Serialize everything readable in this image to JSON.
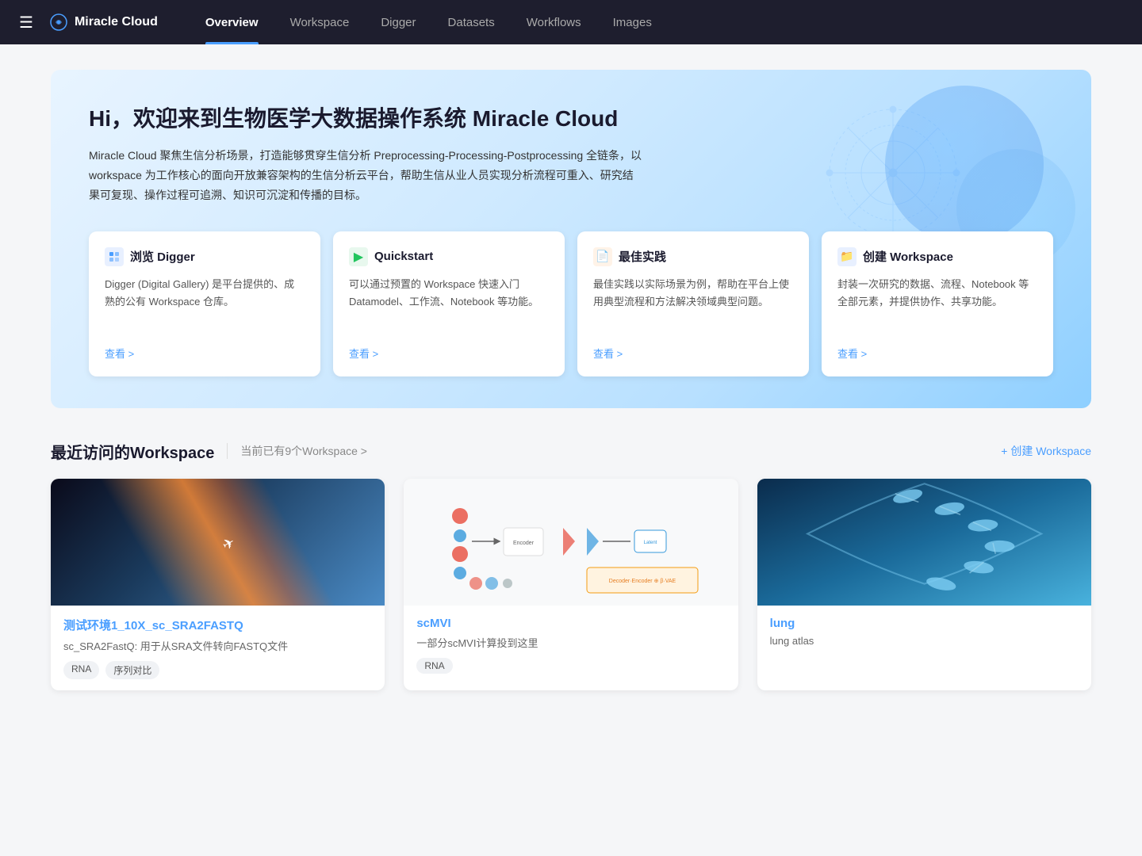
{
  "navbar": {
    "brand": "Miracle Cloud",
    "hamburger_icon": "☰",
    "links": [
      {
        "label": "Overview",
        "active": true
      },
      {
        "label": "Workspace",
        "active": false
      },
      {
        "label": "Digger",
        "active": false
      },
      {
        "label": "Datasets",
        "active": false
      },
      {
        "label": "Workflows",
        "active": false
      },
      {
        "label": "Images",
        "active": false
      }
    ]
  },
  "hero": {
    "title": "Hi，欢迎来到生物医学大数据操作系统 Miracle Cloud",
    "description": "Miracle Cloud 聚焦生信分析场景，打造能够贯穿生信分析 Preprocessing-Processing-Postprocessing 全链条，以 workspace 为工作核心的面向开放兼容架构的生信分析云平台，帮助生信从业人员实现分析流程可重入、研究结果可复现、操作过程可追溯、知识可沉淀和传播的目标。",
    "cards": [
      {
        "id": "digger",
        "icon": "📋",
        "icon_class": "icon-blue",
        "title": "浏览 Digger",
        "desc": "Digger (Digital Gallery) 是平台提供的、成熟的公有 Workspace 仓库。",
        "link": "查看 >"
      },
      {
        "id": "quickstart",
        "icon": "▶",
        "icon_class": "icon-green",
        "title": "Quickstart",
        "desc": "可以通过预置的 Workspace 快速入门 Datamodel、工作流、Notebook 等功能。",
        "link": "查看 >"
      },
      {
        "id": "best-practice",
        "icon": "📄",
        "icon_class": "icon-orange",
        "title": "最佳实践",
        "desc": "最佳实践以实际场景为例，帮助在平台上使用典型流程和方法解决领域典型问题。",
        "link": "查看 >"
      },
      {
        "id": "create-workspace",
        "icon": "📁",
        "icon_class": "icon-darkblue",
        "title": "创建 Workspace",
        "desc": "封装一次研究的数据、流程、Notebook 等全部元素，并提供协作、共享功能。",
        "link": "查看 >"
      }
    ]
  },
  "recent_section": {
    "title": "最近访问的Workspace",
    "subtitle": "当前已有9个Workspace >",
    "action": "+ 创建 Workspace"
  },
  "workspaces": [
    {
      "id": "ws1",
      "name": "测试环境1_10X_sc_SRA2FASTQ",
      "desc": "sc_SRA2FastQ: 用于从SRA文件转向FASTQ文件",
      "tags": [
        "RNA",
        "序列对比"
      ],
      "thumb_type": "space"
    },
    {
      "id": "ws2",
      "name": "scMVI",
      "desc": "一部分scMVI计算投到这里",
      "tags": [
        "RNA"
      ],
      "thumb_type": "diagram"
    },
    {
      "id": "ws3",
      "name": "lung",
      "desc": "lung atlas",
      "tags": [],
      "thumb_type": "dna"
    }
  ]
}
